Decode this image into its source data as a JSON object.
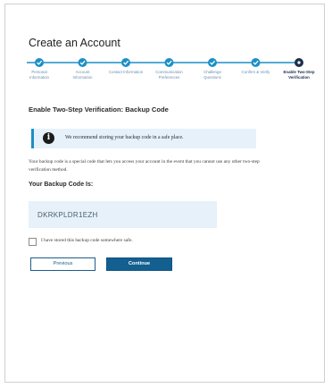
{
  "page": {
    "title": "Create an Account"
  },
  "stepper": {
    "steps": [
      {
        "lines": [
          "Personal",
          "Information"
        ],
        "state": "done"
      },
      {
        "lines": [
          "Account",
          "Information"
        ],
        "state": "done"
      },
      {
        "lines": [
          "Contact Information",
          ""
        ],
        "state": "done"
      },
      {
        "lines": [
          "Communication",
          "Preferences"
        ],
        "state": "done"
      },
      {
        "lines": [
          "Challenge",
          "Questions"
        ],
        "state": "done"
      },
      {
        "lines": [
          "Confirm & Verify",
          ""
        ],
        "state": "done"
      },
      {
        "lines": [
          "Enable Two-Step",
          "Verification"
        ],
        "state": "active"
      }
    ],
    "colors": {
      "done": "#1d8fc6",
      "active": "#1d2f50",
      "line": "#1d8fc6"
    },
    "done_icon": "check-icon",
    "active_icon": "dot-icon"
  },
  "section": {
    "title": "Enable Two-Step Verification: Backup Code"
  },
  "notice": {
    "icon": "info-icon",
    "icon_glyph": "i",
    "text": "We recommend storing your backup code in a safe place."
  },
  "description": {
    "text": "Your backup code is a special code that lets you access your account in the event that you cannot use any other two-step verification method."
  },
  "backup": {
    "label": "Your Backup Code Is:",
    "code": "DKRKPLDR1EZH"
  },
  "confirm": {
    "label": "I have stored this backup code somewhere safe.",
    "checked": false
  },
  "buttons": {
    "previous": "Previous",
    "continue": "Continue"
  },
  "colors": {
    "primary": "#135f8f",
    "accent": "#1d8fc6",
    "notice_bg": "#e6f1f9"
  }
}
